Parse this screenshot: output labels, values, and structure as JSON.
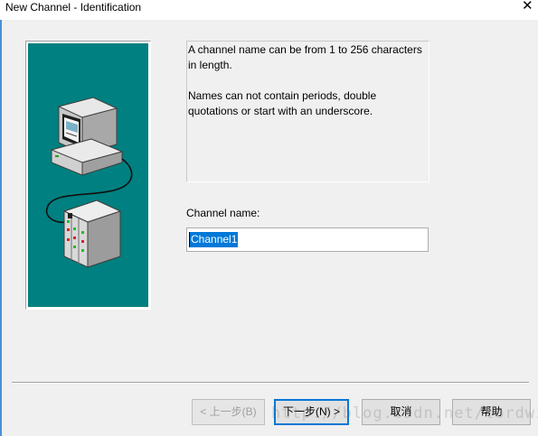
{
  "window": {
    "title": "New Channel - Identification",
    "close_glyph": "✕"
  },
  "info": {
    "line1": "A channel name can be from 1 to 256 characters in length.",
    "line2": "Names can not contain periods, double quotations or start with an underscore."
  },
  "channel": {
    "label": "Channel name:",
    "value": "Channel1"
  },
  "buttons": {
    "back": "< 上一步(B)",
    "next": "下一步(N) >",
    "cancel": "取消",
    "help": "帮助"
  },
  "watermark": "http://blog.csdn.net/lordwish",
  "colors": {
    "panel_bg": "#008080",
    "selection": "#0078d7",
    "default_button_border": "#0078d7"
  }
}
